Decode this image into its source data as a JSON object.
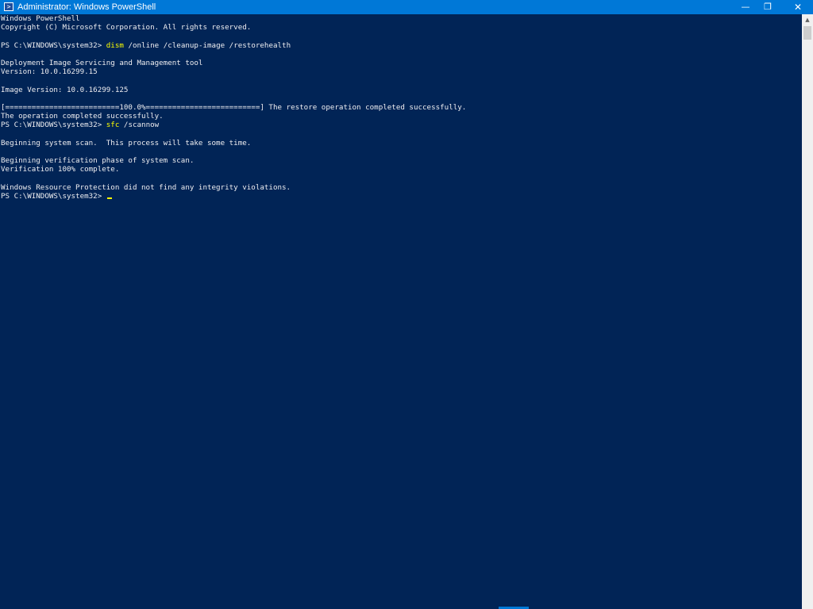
{
  "window": {
    "title": "Administrator: Windows PowerShell",
    "icon": "powershell-icon",
    "controls": {
      "minimize": "—",
      "maximize": "❐",
      "close": "✕"
    },
    "colors": {
      "titlebar": "#0078d7",
      "console_bg": "#012456",
      "text": "#eeedf0",
      "command": "#ffff00"
    }
  },
  "console": {
    "lines": [
      {
        "text": "Windows PowerShell"
      },
      {
        "text": "Copyright (C) Microsoft Corporation. All rights reserved."
      },
      {
        "text": ""
      },
      {
        "prompt": "PS C:\\WINDOWS\\system32> ",
        "command": "dism",
        "args": " /online /cleanup-image /restorehealth"
      },
      {
        "text": ""
      },
      {
        "text": "Deployment Image Servicing and Management tool"
      },
      {
        "text": "Version: 10.0.16299.15"
      },
      {
        "text": ""
      },
      {
        "text": "Image Version: 10.0.16299.125"
      },
      {
        "text": ""
      },
      {
        "text": "[==========================100.0%==========================] The restore operation completed successfully."
      },
      {
        "text": "The operation completed successfully."
      },
      {
        "prompt": "PS C:\\WINDOWS\\system32> ",
        "command": "sfc",
        "args": " /scannow"
      },
      {
        "text": ""
      },
      {
        "text": "Beginning system scan.  This process will take some time."
      },
      {
        "text": ""
      },
      {
        "text": "Beginning verification phase of system scan."
      },
      {
        "text": "Verification 100% complete."
      },
      {
        "text": ""
      },
      {
        "text": "Windows Resource Protection did not find any integrity violations."
      },
      {
        "prompt": "PS C:\\WINDOWS\\system32> ",
        "command": "",
        "args": "",
        "cursor": true
      }
    ]
  },
  "scrollbar": {
    "up_arrow": "▲"
  }
}
